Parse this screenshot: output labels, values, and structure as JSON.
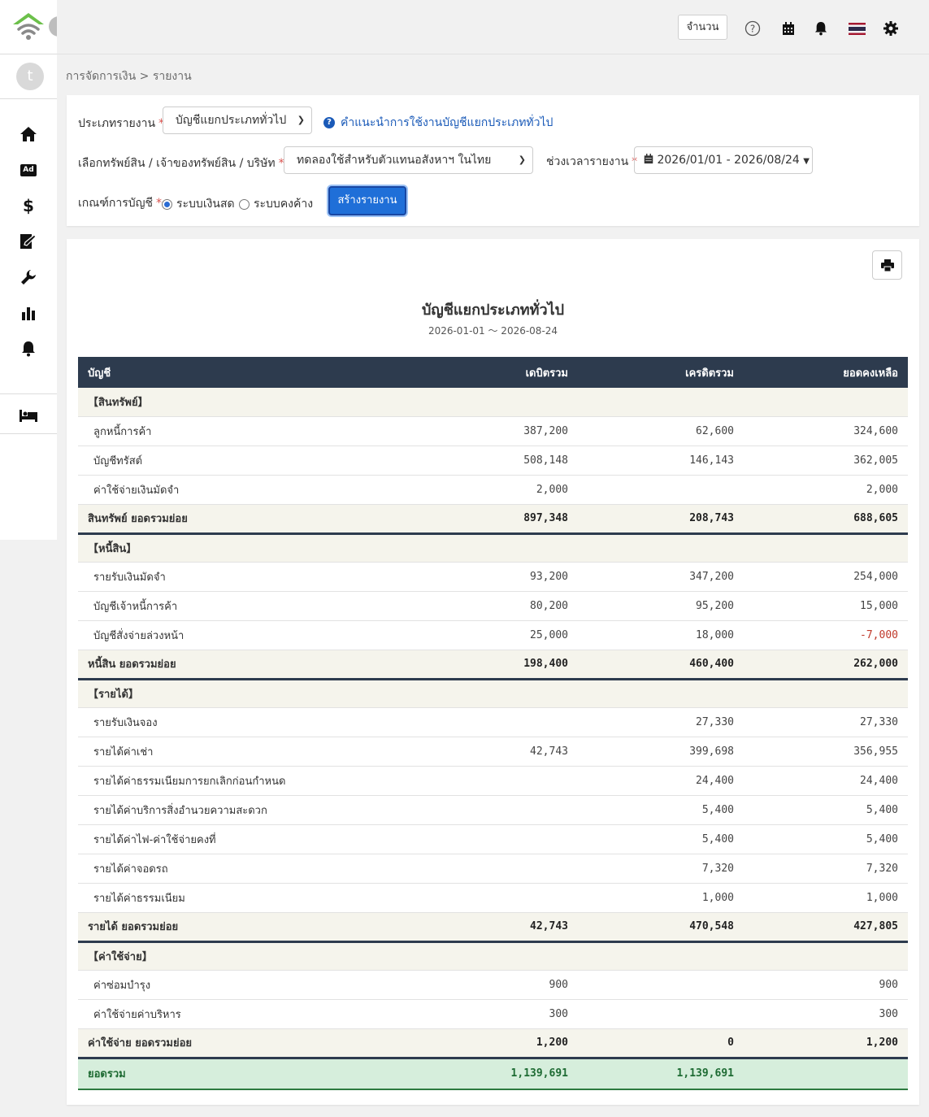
{
  "header": {
    "qty_button": "จำนวน",
    "flag_colors": [
      "#A51931",
      "#F4F5F8",
      "#2D2A4A"
    ]
  },
  "sidebar": {
    "avatar_initial": "t",
    "items": [
      {
        "icon": "home-icon"
      },
      {
        "icon": "ad-icon",
        "label": "Ad"
      },
      {
        "icon": "dollar-icon",
        "label": "$"
      },
      {
        "icon": "edit-document-icon"
      },
      {
        "icon": "wrench-icon"
      },
      {
        "icon": "bar-chart-icon"
      },
      {
        "icon": "bell-icon"
      },
      {
        "icon": "bed-icon"
      }
    ]
  },
  "breadcrumb": "การจัดการเงิน > รายงาน",
  "filters": {
    "report_type_label": "ประเภทรายงาน",
    "report_type_value": "บัญชีแยกประเภททั่วไป",
    "help_link": "คำแนะนำการใช้งานบัญชีแยกประเภททั่วไป",
    "asset_label": "เลือกทรัพย์สิน / เจ้าของทรัพย์สิน / บริษัท",
    "asset_value": "ทดลองใช้สำหรับตัวแทนอสังหาฯ ในไทย",
    "period_label": "ช่วงเวลารายงาน",
    "period_value": "2026/01/01 - 2026/08/24",
    "basis_label": "เกณฑ์การบัญชี",
    "basis_options": [
      "ระบบเงินสด",
      "ระบบคงค้าง"
    ],
    "basis_selected": 0,
    "create_button": "สร้างรายงาน"
  },
  "report": {
    "title": "บัญชีแยกประเภททั่วไป",
    "period": "2026-01-01 〜 2026-08-24",
    "columns": [
      "บัญชี",
      "เดบิตรวม",
      "เครดิตรวม",
      "ยอดคงเหลือ"
    ],
    "sections": [
      {
        "title": "【สินทรัพย์】",
        "rows": [
          {
            "name": "ลูกหนี้การค้า",
            "debit": "387,200",
            "credit": "62,600",
            "balance": "324,600"
          },
          {
            "name": "บัญชีทรัสต์",
            "debit": "508,148",
            "credit": "146,143",
            "balance": "362,005"
          },
          {
            "name": "ค่าใช้จ่ายเงินมัดจำ",
            "debit": "2,000",
            "credit": "",
            "balance": "2,000"
          }
        ],
        "subtotal": {
          "name": "สินทรัพย์ ยอดรวมย่อย",
          "debit": "897,348",
          "credit": "208,743",
          "balance": "688,605"
        }
      },
      {
        "title": "【หนี้สิน】",
        "rows": [
          {
            "name": "รายรับเงินมัดจำ",
            "debit": "93,200",
            "credit": "347,200",
            "balance": "254,000"
          },
          {
            "name": "บัญชีเจ้าหนี้การค้า",
            "debit": "80,200",
            "credit": "95,200",
            "balance": "15,000"
          },
          {
            "name": "บัญชีสั่งจ่ายล่วงหน้า",
            "debit": "25,000",
            "credit": "18,000",
            "balance": "-7,000"
          }
        ],
        "subtotal": {
          "name": "หนี้สิน ยอดรวมย่อย",
          "debit": "198,400",
          "credit": "460,400",
          "balance": "262,000"
        }
      },
      {
        "title": "【รายได้】",
        "rows": [
          {
            "name": "รายรับเงินจอง",
            "debit": "",
            "credit": "27,330",
            "balance": "27,330"
          },
          {
            "name": "รายได้ค่าเช่า",
            "debit": "42,743",
            "credit": "399,698",
            "balance": "356,955"
          },
          {
            "name": "รายได้ค่าธรรมเนียมการยกเลิกก่อนกำหนด",
            "debit": "",
            "credit": "24,400",
            "balance": "24,400"
          },
          {
            "name": "รายได้ค่าบริการสิ่งอำนวยความสะดวก",
            "debit": "",
            "credit": "5,400",
            "balance": "5,400"
          },
          {
            "name": "รายได้ค่าไฟ-ค่าใช้จ่ายคงที่",
            "debit": "",
            "credit": "5,400",
            "balance": "5,400"
          },
          {
            "name": "รายได้ค่าจอดรถ",
            "debit": "",
            "credit": "7,320",
            "balance": "7,320"
          },
          {
            "name": "รายได้ค่าธรรมเนียม",
            "debit": "",
            "credit": "1,000",
            "balance": "1,000"
          }
        ],
        "subtotal": {
          "name": "รายได้ ยอดรวมย่อย",
          "debit": "42,743",
          "credit": "470,548",
          "balance": "427,805"
        }
      },
      {
        "title": "【ค่าใช้จ่าย】",
        "rows": [
          {
            "name": "ค่าซ่อมบำรุง",
            "debit": "900",
            "credit": "",
            "balance": "900"
          },
          {
            "name": "ค่าใช้จ่ายค่าบริหาร",
            "debit": "300",
            "credit": "",
            "balance": "300"
          }
        ],
        "subtotal": {
          "name": "ค่าใช้จ่าย ยอดรวมย่อย",
          "debit": "1,200",
          "credit": "0",
          "balance": "1,200"
        }
      }
    ],
    "total": {
      "name": "ยอดรวม",
      "debit": "1,139,691",
      "credit": "1,139,691",
      "balance": ""
    }
  }
}
